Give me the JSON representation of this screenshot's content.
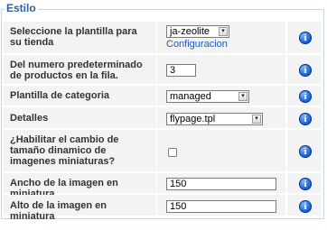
{
  "section": {
    "legend": "Estilo"
  },
  "rows": [
    {
      "label": "Seleccione la plantilla para su tienda",
      "select_value": "ja-zeolite",
      "link": "Configuracion"
    },
    {
      "label": "Del numero predeterminado de productos en la fila.",
      "input_value": "3"
    },
    {
      "label": "Plantilla de categoria",
      "select_value": "managed"
    },
    {
      "label": "Detalles",
      "select_value": "flypage.tpl"
    },
    {
      "label": "¿Habilitar el cambio de tamaño dinamico de imagenes miniaturas?",
      "checked": false
    },
    {
      "label": "Ancho de la imagen en miniatura",
      "input_value": "150"
    },
    {
      "label": "Alto de la imagen en miniatura",
      "input_value": "150"
    }
  ],
  "info_icon": {
    "glyph": "i",
    "icon": "info-icon",
    "color": "#1f6ae0"
  },
  "select_arrow": "▾"
}
